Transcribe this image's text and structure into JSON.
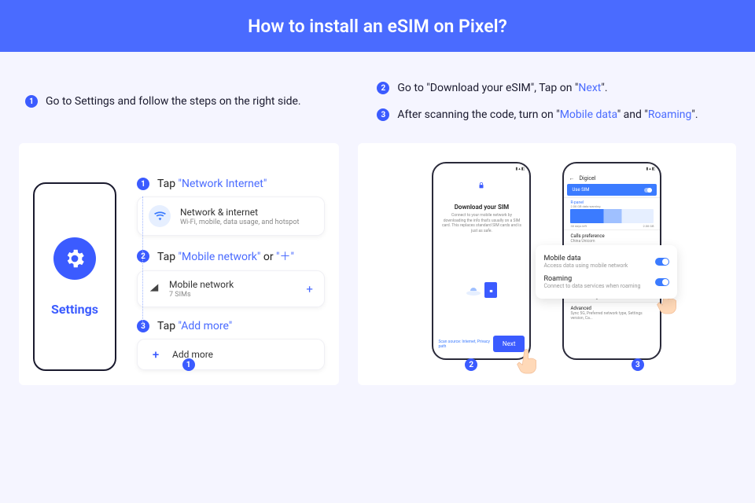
{
  "hero": {
    "title": "How to install an eSIM on Pixel?"
  },
  "intro": {
    "left": {
      "num": "1",
      "text": "Go to Settings and follow the steps on the right side."
    },
    "r1": {
      "num": "2",
      "pre": "Go to \"Download your eSIM\", Tap on \"",
      "hl": "Next",
      "post": "\"."
    },
    "r2": {
      "num": "3",
      "pre": "After scanning the code, turn on \"",
      "hl1": "Mobile data",
      "mid": "\" and \"",
      "hl2": "Roaming",
      "post": "\"."
    }
  },
  "left_card": {
    "settings_label": "Settings",
    "s1": {
      "num": "1",
      "pre": "Tap ",
      "hl": "\"Network Internet\""
    },
    "tile1": {
      "title": "Network & internet",
      "sub": "Wi-Fi, mobile, data usage, and hotspot"
    },
    "s2": {
      "num": "2",
      "pre": "Tap ",
      "hl1": "\"Mobile network\"",
      "mid": " or ",
      "hl2": "\"＋\""
    },
    "tile2": {
      "title": "Mobile network",
      "sub": "7 SIMs",
      "plus": "+"
    },
    "s3": {
      "num": "3",
      "pre": "Tap ",
      "hl": "\"Add more\""
    },
    "tile3": {
      "plus": "+",
      "title": "Add more"
    },
    "page": "1"
  },
  "right_card": {
    "mock2": {
      "title": "Download your SIM",
      "sub": "Connect to your mobile network by downloading the info that's usually on a SIM card. This replaces standard SIM cards and is just as safe.",
      "links": "Scan source: Internet, Privacy path",
      "next": "Next"
    },
    "mock3": {
      "carrier": "Digicel",
      "use_sim": "Use SIM",
      "h_lbl": "R-panel",
      "h_val": "",
      "data_lbl": "2.08 GB data warning",
      "data_val": "30 days left",
      "cap": "2.08 GB",
      "pref_lbl": "Calls preference",
      "pref_val": "China Unicom",
      "warn": "Data warning & limit",
      "adv_lbl": "Advanced",
      "adv_val": "Sync 5G, Preferred network type, Settings version, Ca..."
    },
    "overlay": {
      "r1_t": "Mobile data",
      "r1_s": "Access data using mobile network",
      "r2_t": "Roaming",
      "r2_s": "Connect to data services when roaming"
    },
    "page2": "2",
    "page3": "3"
  }
}
